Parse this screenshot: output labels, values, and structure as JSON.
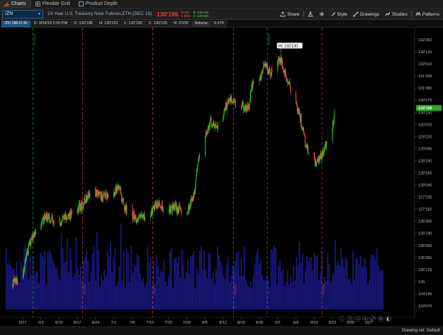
{
  "tabs": [
    {
      "label": "Charts",
      "icon": "chart-icon",
      "active": true
    },
    {
      "label": "Flexible Grid",
      "icon": "grid-icon",
      "active": false
    },
    {
      "label": "Product Depth",
      "icon": "depth-icon",
      "active": false
    }
  ],
  "toolbar": {
    "symbol": "/ZN",
    "description": "10-Year U.S. Treasury Note Futures,ETH (DEC 19)",
    "last_price": "130'195",
    "net_change": "-01'05",
    "percent_change": "-0.08%",
    "bid": "B: 130'195",
    "ask": "A: 130'200",
    "share_label": "Share",
    "style_label": "Style",
    "drawings_label": "Drawings",
    "studies_label": "Studies",
    "patterns_label": "Patterns"
  },
  "infobar": {
    "symbol_period": "/ZN 180 D 4h",
    "date": "D: 9/24/19 5:00 PM",
    "open": "O: 130'185",
    "high": "H: 130'215",
    "low": "L: 130'185",
    "close": "C: 130'195",
    "range": "R: 0'030",
    "volume_label": "Volume",
    "volume_value": "8,474"
  },
  "colors": {
    "up": "#1fd11f",
    "down": "#ff4a4a",
    "volume": "#1a1a8c",
    "expiry_line": "#b73a3a",
    "roll_line": "#1e8c3a",
    "price_marker": "#1db31d"
  },
  "chart_data": {
    "type": "candlestick",
    "x_ticks": [
      "5/27",
      "6/3",
      "6/10",
      "6/17",
      "6/24",
      "7/1",
      "7/8",
      "7/15",
      "7/22",
      "7/29",
      "8/5",
      "8/12",
      "8/19",
      "8/26",
      "9/2",
      "9/9",
      "9/16",
      "9/23",
      "9/30",
      "10/7"
    ],
    "y_ticks": [
      "132'260",
      "132'135",
      "132'010",
      "131'205",
      "131'080",
      "130'275",
      "130'150",
      "130'025",
      "129'220",
      "129'095",
      "128'290",
      "128'165",
      "128'040",
      "127'235",
      "127'110",
      "126'305",
      "126'180",
      "126'055",
      "125'250",
      "125'125",
      "125",
      "124'195",
      "124'070"
    ],
    "y_range_32nds": [
      "124'070",
      "132'260"
    ],
    "last_price": "130'195",
    "high_label": "Hi: 132'130",
    "anchors": [
      {
        "date": "5/23",
        "price": 124.9
      },
      {
        "date": "5/27",
        "price": 125.3
      },
      {
        "date": "5/30",
        "price": 126.3
      },
      {
        "date": "6/3",
        "price": 126.9
      },
      {
        "date": "6/5",
        "price": 127.1
      },
      {
        "date": "6/7",
        "price": 127.0
      },
      {
        "date": "6/10",
        "price": 126.9
      },
      {
        "date": "6/13",
        "price": 127.1
      },
      {
        "date": "6/17",
        "price": 127.3
      },
      {
        "date": "6/20",
        "price": 127.6
      },
      {
        "date": "6/21",
        "price": 127.8
      },
      {
        "date": "6/24",
        "price": 127.9
      },
      {
        "date": "6/27",
        "price": 127.7
      },
      {
        "date": "7/1",
        "price": 127.9
      },
      {
        "date": "7/3",
        "price": 128.1
      },
      {
        "date": "7/5",
        "price": 127.4
      },
      {
        "date": "7/8",
        "price": 127.2
      },
      {
        "date": "7/10",
        "price": 127.0
      },
      {
        "date": "7/15",
        "price": 127.2
      },
      {
        "date": "7/18",
        "price": 127.5
      },
      {
        "date": "7/22",
        "price": 127.3
      },
      {
        "date": "7/25",
        "price": 127.4
      },
      {
        "date": "7/29",
        "price": 127.2
      },
      {
        "date": "8/1",
        "price": 127.9
      },
      {
        "date": "8/2",
        "price": 128.7
      },
      {
        "date": "8/5",
        "price": 129.6
      },
      {
        "date": "8/7",
        "price": 130.2
      },
      {
        "date": "8/9",
        "price": 130.0
      },
      {
        "date": "8/12",
        "price": 130.3
      },
      {
        "date": "8/14",
        "price": 130.9
      },
      {
        "date": "8/16",
        "price": 130.8
      },
      {
        "date": "8/19",
        "price": 130.7
      },
      {
        "date": "8/22",
        "price": 130.6
      },
      {
        "date": "8/23",
        "price": 131.3
      },
      {
        "date": "8/26",
        "price": 131.5
      },
      {
        "date": "8/28",
        "price": 132.1
      },
      {
        "date": "8/30",
        "price": 131.7
      },
      {
        "date": "9/3",
        "price": 132.2
      },
      {
        "date": "9/4",
        "price": 131.9
      },
      {
        "date": "9/6",
        "price": 131.4
      },
      {
        "date": "9/9",
        "price": 130.8
      },
      {
        "date": "9/11",
        "price": 130.2
      },
      {
        "date": "9/13",
        "price": 129.3
      },
      {
        "date": "9/17",
        "price": 128.8
      },
      {
        "date": "9/19",
        "price": 129.1
      },
      {
        "date": "9/21",
        "price": 129.5
      },
      {
        "date": "9/23",
        "price": 130.0
      },
      {
        "date": "9/24",
        "price": 130.6
      }
    ],
    "volume_range": [
      0,
      40000
    ],
    "expiry_dates": [
      "6/19",
      "7/16",
      "8/16",
      "9/19"
    ],
    "roll_dates": [
      "5/31",
      "8/29"
    ],
    "roll_labels": [
      "5/31/19",
      "8/29/19"
    ],
    "expiry_labels": [
      "6/19/19",
      "7/16/19",
      "8/16/19",
      "9/19/19"
    ]
  },
  "status": {
    "drawing_set": "Drawing set: Default"
  }
}
